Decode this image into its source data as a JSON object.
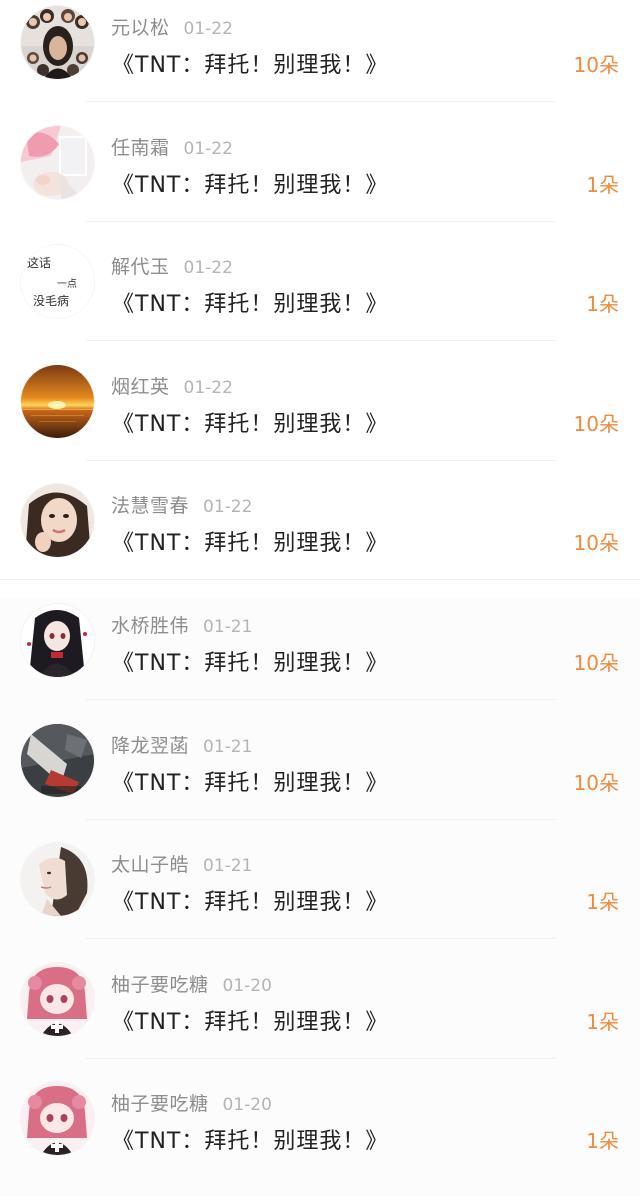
{
  "rewards": [
    {
      "name": "元以松",
      "date": "01-22",
      "title": "《TNT：拜托！别理我！》",
      "amount": "10朵",
      "avatar": "kpop-group-avatar"
    },
    {
      "name": "任南霜",
      "date": "01-22",
      "title": "《TNT：拜托！别理我！》",
      "amount": "1朵",
      "avatar": "pink-dress-avatar"
    },
    {
      "name": "解代玉",
      "date": "01-22",
      "title": "《TNT：拜托！别理我！》",
      "amount": "1朵",
      "avatar": "handwritten-text-avatar",
      "avatar_text": [
        "这话",
        "一点",
        "没毛病"
      ]
    },
    {
      "name": "烟红英",
      "date": "01-22",
      "title": "《TNT：拜托！别理我！》",
      "amount": "10朵",
      "avatar": "sunset-sea-avatar"
    },
    {
      "name": "法慧雪春",
      "date": "01-22",
      "title": "《TNT：拜托！别理我！》",
      "amount": "10朵",
      "avatar": "girl-portrait-avatar"
    },
    {
      "name": "水桥胜伟",
      "date": "01-21",
      "title": "《TNT：拜托！别理我！》",
      "amount": "10朵",
      "avatar": "anime-girl-avatar"
    },
    {
      "name": "降龙翌菡",
      "date": "01-21",
      "title": "《TNT：拜托！别理我！》",
      "amount": "10朵",
      "avatar": "dark-photo-avatar"
    },
    {
      "name": "太山子皓",
      "date": "01-21",
      "title": "《TNT：拜托！别理我！》",
      "amount": "1朵",
      "avatar": "side-profile-avatar"
    },
    {
      "name": "柚子要吃糖",
      "date": "01-20",
      "title": "《TNT：拜托！别理我！》",
      "amount": "1朵",
      "avatar": "pink-anime-avatar"
    },
    {
      "name": "柚子要吃糖",
      "date": "01-20",
      "title": "《TNT：拜托！别理我！》",
      "amount": "1朵",
      "avatar": "pink-anime-avatar"
    }
  ],
  "colors": {
    "amount": "#f08a3c",
    "name": "#8d8d8d",
    "date": "#b4b4b4",
    "title": "#222222"
  }
}
